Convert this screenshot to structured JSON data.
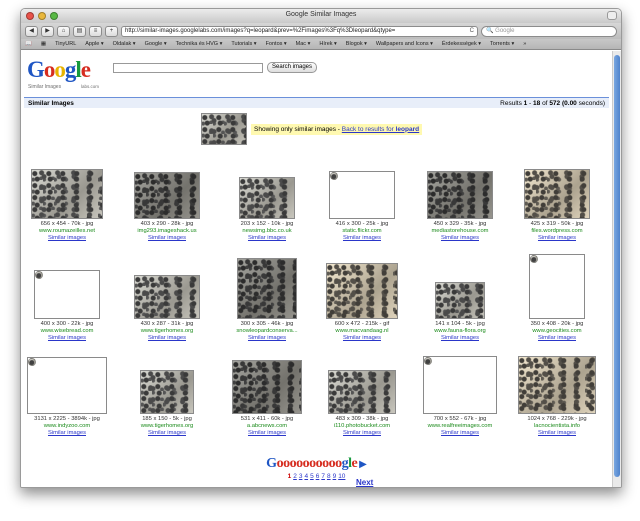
{
  "window": {
    "title": "Google Similar Images"
  },
  "toolbar": {
    "url": "http://similar-images.googlelabs.com/images?q=leopard&prev=%2Fimages%3Fq%3Dleopard&qtype=",
    "search_placeholder": "Google"
  },
  "bookmarks": [
    "TinyURL",
    "Apple ▾",
    "Oldalak ▾",
    "Google ▾",
    "Technika és HVG ▾",
    "Tutorials ▾",
    "Fontos ▾",
    "Mac ▾",
    "Hírek ▾",
    "Blogok ▾",
    "Wallpapers and Icons ▾",
    "Érdekességek ▾",
    "Torrents ▾",
    "»"
  ],
  "header": {
    "logo_sub": "Similar Images",
    "logo_sub2": "labs.com",
    "search_button": "Search images"
  },
  "resultbar": {
    "heading": "Similar Images",
    "results_prefix": "Results ",
    "range_start": "1",
    "range_sep": " - ",
    "range_end": "18",
    "of": " of ",
    "total": "572",
    "time": "(0.00",
    "time_suffix": " seconds)"
  },
  "notice": {
    "text": "Showing only similar images - ",
    "back_link": "Back to results for ",
    "query": "leopard"
  },
  "images": [
    {
      "dims": "656 x 454 - 70k - jpg",
      "domain": "www.roumazeilles.net",
      "similar": "Similar images"
    },
    {
      "dims": "403 x 290 - 28k - jpg",
      "domain": "img293.imageshack.us",
      "similar": "Similar images"
    },
    {
      "dims": "203 x 152 - 10k - jpg",
      "domain": "newsimg.bbc.co.uk",
      "similar": "Similar images"
    },
    {
      "dims": "416 x 300 - 25k - jpg",
      "domain": "static.flickr.com",
      "similar": "Similar images"
    },
    {
      "dims": "450 x 329 - 35k - jpg",
      "domain": "mediastorehouse.com",
      "similar": "Similar images"
    },
    {
      "dims": "425 x 319 - 50k - jpg",
      "domain": "files.wordpress.com",
      "similar": "Similar images"
    },
    {
      "dims": "400 x 300 - 22k - jpg",
      "domain": "www.wisebread.com",
      "similar": "Similar images"
    },
    {
      "dims": "430 x 287 - 31k - jpg",
      "domain": "www.tigerhomes.org",
      "similar": "Similar images"
    },
    {
      "dims": "300 x 305 - 46k - jpg",
      "domain": "snowleopardconserva...",
      "similar": "Similar images"
    },
    {
      "dims": "600 x 472 - 215k - gif",
      "domain": "www.macvandaag.nl",
      "similar": "Similar images"
    },
    {
      "dims": "141 x 104 - 5k - jpg",
      "domain": "www.fauna-flora.org",
      "similar": "Similar images"
    },
    {
      "dims": "350 x 408 - 20k - jpg",
      "domain": "www.geocities.com",
      "similar": "Similar images"
    },
    {
      "dims": "3131 x 2225 - 3894k - jpg",
      "domain": "www.indyzoo.com",
      "similar": "Similar images"
    },
    {
      "dims": "185 x 150 - 5k - jpg",
      "domain": "www.tigerhomes.org",
      "similar": "Similar images"
    },
    {
      "dims": "531 x 411 - 60k - jpg",
      "domain": "a.abcnews.com",
      "similar": "Similar images"
    },
    {
      "dims": "483 x 309 - 38k - jpg",
      "domain": "i110.photobucket.com",
      "similar": "Similar images"
    },
    {
      "dims": "700 x 552 - 67k - jpg",
      "domain": "www.realfreeimages.com",
      "similar": "Similar images"
    },
    {
      "dims": "1024 x 768 - 229k - jpg",
      "domain": "lacnocientista.info",
      "similar": "Similar images"
    }
  ],
  "pager": {
    "logo_G": "G",
    "logo_o": "oooooooooo",
    "logo_g": "g",
    "logo_l": "l",
    "logo_e": "e",
    "arrow": "▶",
    "pages": [
      "1",
      "2",
      "3",
      "4",
      "5",
      "6",
      "7",
      "8",
      "9",
      "10"
    ],
    "next": "Next"
  }
}
